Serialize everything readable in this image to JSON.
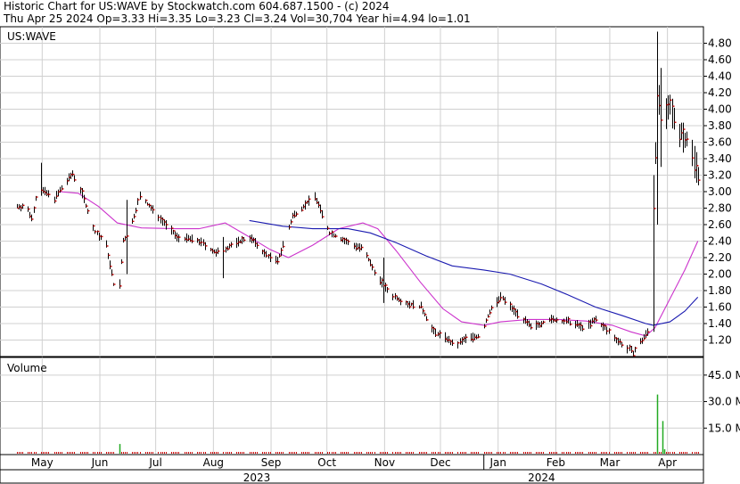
{
  "header": {
    "line1": "Historic Chart for US:WAVE by Stockwatch.com 604.687.1500 - (c) 2024",
    "line2": "Thu Apr 25 2024   Op=3.33  Hi=3.35  Lo=3.23  Cl=3.24  Vol=30,704  Year hi=4.94  lo=1.01"
  },
  "colors": {
    "bar_body": "#000000",
    "close_tick": "#cc0000",
    "ma_short": "#cc33cc",
    "ma_long": "#1a1ab0",
    "volume": "#22aa22",
    "grid": "#d0d0d0",
    "frame": "#000000"
  },
  "chart_data": [
    {
      "type": "ohlc",
      "symbol_label": "US:WAVE",
      "y_ticks": [
        "4.80",
        "4.60",
        "4.40",
        "4.20",
        "4.00",
        "3.80",
        "3.60",
        "3.40",
        "3.20",
        "3.00",
        "2.80",
        "2.60",
        "2.40",
        "2.20",
        "2.00",
        "1.80",
        "1.60",
        "1.40",
        "1.20"
      ],
      "ylim": [
        1.0,
        5.0
      ],
      "grid": true,
      "x_range": [
        "2023-04-25",
        "2024-04-25"
      ],
      "month_labels": [
        "Apr",
        "May",
        "Jun",
        "Jul",
        "Aug",
        "Sep",
        "Oct",
        "Nov",
        "Dec",
        "Jan",
        "Feb",
        "Mar",
        "Apr"
      ],
      "month_dates": [
        "2023-04-01",
        "2023-05-01",
        "2023-06-01",
        "2023-07-01",
        "2023-08-01",
        "2023-09-01",
        "2023-10-01",
        "2023-11-01",
        "2023-12-01",
        "2024-01-01",
        "2024-02-01",
        "2024-03-01",
        "2024-04-01"
      ],
      "year_labels": [
        "2023",
        "2024"
      ],
      "year_label_dates": [
        "2023-09-01",
        "2024-02-01"
      ],
      "year_split_date": "2024-01-01",
      "price_anchors": [
        [
          "2023-04-25",
          2.82
        ],
        [
          "2023-04-30",
          2.82
        ],
        [
          "2023-05-03",
          2.68
        ],
        [
          "2023-05-06",
          3.05
        ],
        [
          "2023-05-15",
          2.92
        ],
        [
          "2023-05-25",
          3.22
        ],
        [
          "2023-05-30",
          2.98
        ],
        [
          "2023-06-05",
          2.55
        ],
        [
          "2023-06-12",
          2.35
        ],
        [
          "2023-06-15",
          2.0
        ],
        [
          "2023-06-18",
          1.62
        ],
        [
          "2023-06-21",
          2.4
        ],
        [
          "2023-06-25",
          2.55
        ],
        [
          "2023-06-30",
          2.95
        ],
        [
          "2023-07-10",
          2.7
        ],
        [
          "2023-07-20",
          2.45
        ],
        [
          "2023-08-01",
          2.4
        ],
        [
          "2023-08-10",
          2.25
        ],
        [
          "2023-08-18",
          2.35
        ],
        [
          "2023-08-28",
          2.45
        ],
        [
          "2023-09-05",
          2.25
        ],
        [
          "2023-09-12",
          2.15
        ],
        [
          "2023-09-20",
          2.7
        ],
        [
          "2023-10-02",
          2.95
        ],
        [
          "2023-10-10",
          2.5
        ],
        [
          "2023-10-20",
          2.38
        ],
        [
          "2023-10-28",
          2.3
        ],
        [
          "2023-11-05",
          1.95
        ],
        [
          "2023-11-12",
          1.75
        ],
        [
          "2023-11-20",
          1.65
        ],
        [
          "2023-11-28",
          1.6
        ],
        [
          "2023-12-05",
          1.3
        ],
        [
          "2023-12-12",
          1.22
        ],
        [
          "2023-12-16",
          1.12
        ],
        [
          "2023-12-22",
          1.22
        ],
        [
          "2023-12-30",
          1.25
        ],
        [
          "2024-01-04",
          1.55
        ],
        [
          "2024-01-10",
          1.72
        ],
        [
          "2024-01-20",
          1.5
        ],
        [
          "2024-01-26",
          1.35
        ],
        [
          "2024-02-05",
          1.45
        ],
        [
          "2024-02-15",
          1.42
        ],
        [
          "2024-02-24",
          1.35
        ],
        [
          "2024-03-01",
          1.45
        ],
        [
          "2024-03-08",
          1.3
        ],
        [
          "2024-03-15",
          1.15
        ],
        [
          "2024-03-21",
          1.05
        ],
        [
          "2024-03-26",
          1.2
        ],
        [
          "2024-03-29",
          1.3
        ],
        [
          "2024-04-01",
          2.8
        ],
        [
          "2024-04-03",
          4.2
        ],
        [
          "2024-04-06",
          3.8
        ],
        [
          "2024-04-10",
          4.0
        ],
        [
          "2024-04-15",
          3.75
        ],
        [
          "2024-04-20",
          3.6
        ],
        [
          "2024-04-25",
          3.24
        ]
      ],
      "spikes": [
        {
          "date": "2023-04-25",
          "hi": 2.85,
          "lo": 2.8
        },
        {
          "date": "2023-05-08",
          "hi": 3.35,
          "lo": 2.95
        },
        {
          "date": "2023-06-10",
          "hi": 2.4,
          "lo": 2.1
        },
        {
          "date": "2023-06-17",
          "hi": 2.2,
          "lo": 1.42
        },
        {
          "date": "2023-06-23",
          "hi": 2.9,
          "lo": 2.0
        },
        {
          "date": "2023-08-14",
          "hi": 2.45,
          "lo": 1.95
        },
        {
          "date": "2023-11-08",
          "hi": 2.2,
          "lo": 1.65
        },
        {
          "date": "2023-12-16",
          "hi": 1.28,
          "lo": 1.01
        },
        {
          "date": "2024-04-01",
          "hi": 3.2,
          "lo": 1.3
        },
        {
          "date": "2024-04-03",
          "hi": 4.94,
          "lo": 2.6
        },
        {
          "date": "2024-04-05",
          "hi": 4.5,
          "lo": 3.3
        }
      ],
      "moving_averages": [
        {
          "color_key": "ma_short",
          "points": [
            [
              "2023-05-18",
              3.0
            ],
            [
              "2023-05-28",
              2.98
            ],
            [
              "2023-06-08",
              2.82
            ],
            [
              "2023-06-18",
              2.62
            ],
            [
              "2023-07-01",
              2.56
            ],
            [
              "2023-07-20",
              2.55
            ],
            [
              "2023-08-01",
              2.55
            ],
            [
              "2023-08-15",
              2.62
            ],
            [
              "2023-08-28",
              2.45
            ],
            [
              "2023-09-08",
              2.3
            ],
            [
              "2023-09-18",
              2.2
            ],
            [
              "2023-10-01",
              2.35
            ],
            [
              "2023-10-15",
              2.55
            ],
            [
              "2023-10-28",
              2.62
            ],
            [
              "2023-11-05",
              2.55
            ],
            [
              "2023-11-15",
              2.28
            ],
            [
              "2023-11-28",
              1.9
            ],
            [
              "2023-12-10",
              1.58
            ],
            [
              "2023-12-20",
              1.42
            ],
            [
              "2024-01-01",
              1.38
            ],
            [
              "2024-01-10",
              1.42
            ],
            [
              "2024-01-25",
              1.45
            ],
            [
              "2024-02-10",
              1.45
            ],
            [
              "2024-02-25",
              1.43
            ],
            [
              "2024-03-10",
              1.38
            ],
            [
              "2024-03-20",
              1.3
            ],
            [
              "2024-03-28",
              1.25
            ],
            [
              "2024-04-02",
              1.35
            ],
            [
              "2024-04-10",
              1.7
            ],
            [
              "2024-04-18",
              2.05
            ],
            [
              "2024-04-25",
              2.4
            ]
          ]
        },
        {
          "color_key": "ma_long",
          "points": [
            [
              "2023-08-28",
              2.65
            ],
            [
              "2023-09-15",
              2.58
            ],
            [
              "2023-10-01",
              2.55
            ],
            [
              "2023-10-20",
              2.55
            ],
            [
              "2023-11-01",
              2.5
            ],
            [
              "2023-11-15",
              2.38
            ],
            [
              "2023-12-01",
              2.22
            ],
            [
              "2023-12-15",
              2.1
            ],
            [
              "2024-01-01",
              2.05
            ],
            [
              "2024-01-15",
              2.0
            ],
            [
              "2024-02-01",
              1.88
            ],
            [
              "2024-02-15",
              1.75
            ],
            [
              "2024-03-01",
              1.6
            ],
            [
              "2024-03-15",
              1.5
            ],
            [
              "2024-03-28",
              1.4
            ],
            [
              "2024-04-01",
              1.38
            ],
            [
              "2024-04-10",
              1.42
            ],
            [
              "2024-04-18",
              1.55
            ],
            [
              "2024-04-25",
              1.72
            ]
          ]
        }
      ]
    },
    {
      "type": "bar",
      "title": "Volume",
      "y_ticks": [
        "45.0 M",
        "30.0 M",
        "15.0 M"
      ],
      "y_tick_values": [
        45,
        30,
        15
      ],
      "unit": "M",
      "ylim": [
        0,
        55
      ],
      "grid": true,
      "baseline_volume_M": 0.5,
      "bars": [
        {
          "date": "2023-06-19",
          "value": 6
        },
        {
          "date": "2024-04-03",
          "value": 34
        },
        {
          "date": "2024-04-06",
          "value": 19
        },
        {
          "date": "2024-04-07",
          "value": 3
        }
      ]
    }
  ]
}
